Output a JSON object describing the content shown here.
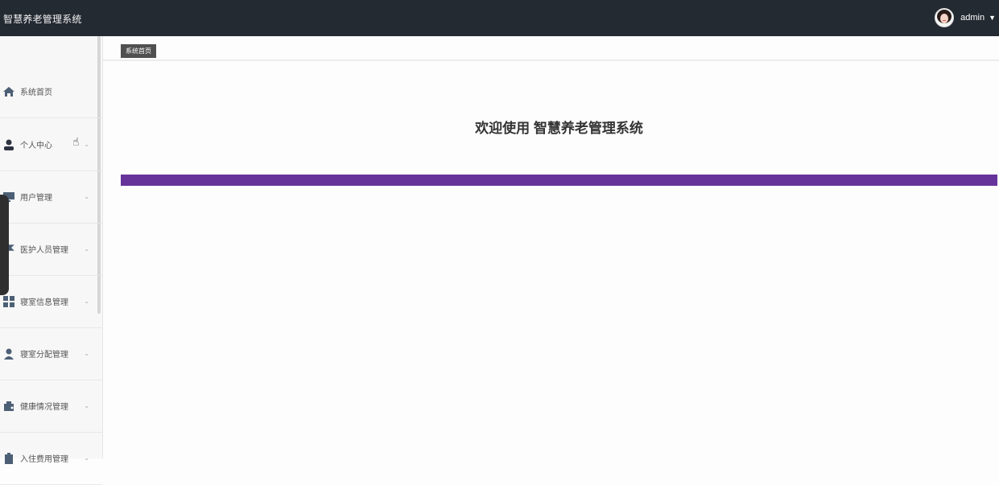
{
  "header": {
    "app_title": "智慧养老管理系统",
    "user_name": "admin"
  },
  "sidebar": {
    "items": [
      {
        "label": "系统首页",
        "icon": "home-icon"
      },
      {
        "label": "个人中心",
        "icon": "user-icon"
      },
      {
        "label": "用户管理",
        "icon": "monitor-icon"
      },
      {
        "label": "医护人员管理",
        "icon": "flag-icon"
      },
      {
        "label": "寝室信息管理",
        "icon": "grid-icon"
      },
      {
        "label": "寝室分配管理",
        "icon": "person-icon"
      },
      {
        "label": "健康情况管理",
        "icon": "briefcase-icon"
      },
      {
        "label": "入住费用管理",
        "icon": "clipboard-icon"
      }
    ]
  },
  "main": {
    "breadcrumb": "系统首页",
    "welcome": "欢迎使用 智慧养老管理系统"
  },
  "colors": {
    "topbar": "#242a32",
    "accent_bar": "#66339a",
    "breadcrumb_bg": "#505050"
  }
}
